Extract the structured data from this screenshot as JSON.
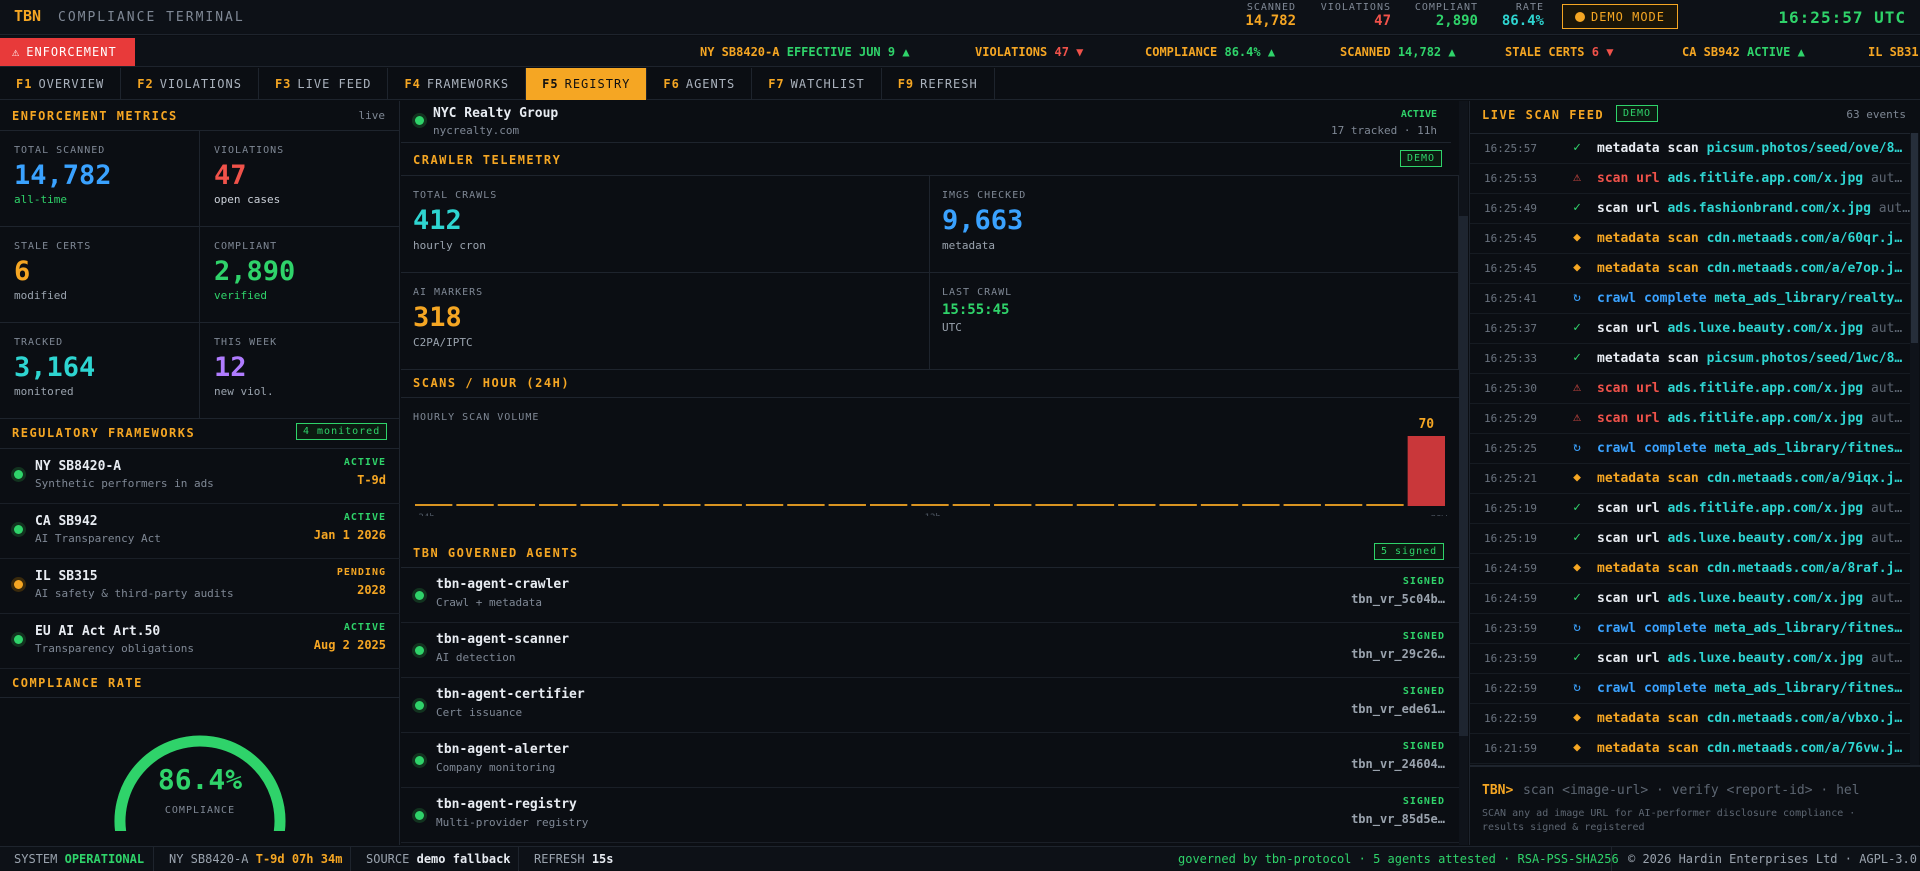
{
  "header": {
    "brand": "TBN",
    "subtitle": "COMPLIANCE TERMINAL",
    "stats": [
      {
        "label": "SCANNED",
        "value": "14,782"
      },
      {
        "label": "VIOLATIONS",
        "value": "47"
      },
      {
        "label": "COMPLIANT",
        "value": "2,890"
      },
      {
        "label": "RATE",
        "value": "86.4%"
      }
    ],
    "demo_mode": "DEMO MODE",
    "clock": "16:25:57 UTC"
  },
  "ticker": {
    "badge": "ENFORCEMENT",
    "items": [
      {
        "label": "NY SB8420-A",
        "value": "EFFECTIVE JUN 9",
        "arrow": "▲",
        "color": "#2fd36a"
      },
      {
        "label": "VIOLATIONS",
        "value": "47",
        "arrow": "▼",
        "color": "#f0524a"
      },
      {
        "label": "COMPLIANCE",
        "value": "86.4%",
        "arrow": "▲",
        "color": "#2fd36a"
      },
      {
        "label": "SCANNED",
        "value": "14,782",
        "arrow": "▲",
        "color": "#2fd36a"
      },
      {
        "label": "STALE CERTS",
        "value": "6",
        "arrow": "▼",
        "color": "#f0524a"
      },
      {
        "label": "CA SB942",
        "value": "ACTIVE",
        "arrow": "▲",
        "color": "#2fd36a"
      },
      {
        "label": "IL SB31",
        "value": "",
        "arrow": "",
        "color": "#2fd36a"
      }
    ]
  },
  "nav": [
    {
      "key": "F1",
      "label": "OVERVIEW"
    },
    {
      "key": "F2",
      "label": "VIOLATIONS"
    },
    {
      "key": "F3",
      "label": "LIVE FEED"
    },
    {
      "key": "F4",
      "label": "FRAMEWORKS"
    },
    {
      "key": "F5",
      "label": "REGISTRY"
    },
    {
      "key": "F6",
      "label": "AGENTS"
    },
    {
      "key": "F7",
      "label": "WATCHLIST"
    },
    {
      "key": "F9",
      "label": "REFRESH"
    }
  ],
  "metrics": {
    "title": "ENFORCEMENT METRICS",
    "tag": "live",
    "cells": [
      {
        "label": "TOTAL SCANNED",
        "value": "14,782",
        "sub": "all-time"
      },
      {
        "label": "VIOLATIONS",
        "value": "47",
        "sub": "open cases"
      },
      {
        "label": "STALE CERTS",
        "value": "6",
        "sub": "modified"
      },
      {
        "label": "COMPLIANT",
        "value": "2,890",
        "sub": "verified"
      },
      {
        "label": "TRACKED",
        "value": "3,164",
        "sub": "monitored"
      },
      {
        "label": "THIS WEEK",
        "value": "12",
        "sub": "new viol."
      }
    ]
  },
  "frameworks": {
    "title": "REGULATORY FRAMEWORKS",
    "badge": "4 monitored",
    "items": [
      {
        "name": "NY SB8420-A",
        "desc": "Synthetic performers in ads",
        "status": "ACTIVE",
        "date": "T-9d"
      },
      {
        "name": "CA SB942",
        "desc": "AI Transparency Act",
        "status": "ACTIVE",
        "date": "Jan 1 2026"
      },
      {
        "name": "IL SB315",
        "desc": "AI safety & third-party audits",
        "status": "PENDING",
        "date": "2028"
      },
      {
        "name": "EU AI Act Art.50",
        "desc": "Transparency obligations",
        "status": "ACTIVE",
        "date": "Aug 2 2025"
      }
    ]
  },
  "compliance": {
    "title": "COMPLIANCE RATE",
    "value": "86.4%",
    "fraction": 0.864,
    "label": "COMPLIANCE"
  },
  "registry_top": {
    "name": "NYC Realty Group",
    "domain": "nycrealty.com",
    "status": "ACTIVE",
    "meta": "17 tracked · 11h"
  },
  "telemetry": {
    "title": "CRAWLER TELEMETRY",
    "badge": "DEMO",
    "cells": [
      {
        "label": "TOTAL CRAWLS",
        "value": "412",
        "sub": "hourly cron"
      },
      {
        "label": "IMGS CHECKED",
        "value": "9,663",
        "sub": "metadata"
      },
      {
        "label": "AI MARKERS",
        "value": "318",
        "sub": "C2PA/IPTC"
      },
      {
        "label": "LAST CRAWL",
        "value": "15:55:45",
        "sub": "UTC"
      }
    ]
  },
  "scans_chart": {
    "title": "SCANS / HOUR (24H)",
    "subtitle": "HOURLY SCAN VOLUME",
    "peak_label": "70",
    "x_labels": [
      "-24h",
      "-12h",
      "now"
    ]
  },
  "chart_data": {
    "type": "bar",
    "title": "SCANS / HOUR (24H)",
    "subtitle": "HOURLY SCAN VOLUME",
    "categories": [
      "-24h",
      "",
      "",
      "",
      "",
      "",
      "",
      "",
      "",
      "",
      "",
      "",
      "-12h",
      "",
      "",
      "",
      "",
      "",
      "",
      "",
      "",
      "",
      "",
      "",
      "now"
    ],
    "values": [
      0,
      0,
      0,
      0,
      0,
      0,
      0,
      0,
      0,
      0,
      0,
      0,
      0,
      0,
      0,
      0,
      0,
      0,
      0,
      0,
      0,
      0,
      0,
      0,
      70
    ],
    "ylim": [
      0,
      70
    ]
  },
  "agents": {
    "title": "TBN GOVERNED AGENTS",
    "badge": "5 signed",
    "items": [
      {
        "name": "tbn-agent-crawler",
        "desc": "Crawl + metadata",
        "status": "SIGNED",
        "hash": "tbn_vr_5c04b…"
      },
      {
        "name": "tbn-agent-scanner",
        "desc": "AI detection",
        "status": "SIGNED",
        "hash": "tbn_vr_29c26…"
      },
      {
        "name": "tbn-agent-certifier",
        "desc": "Cert issuance",
        "status": "SIGNED",
        "hash": "tbn_vr_ede61…"
      },
      {
        "name": "tbn-agent-alerter",
        "desc": "Company monitoring",
        "status": "SIGNED",
        "hash": "tbn_vr_24604…"
      },
      {
        "name": "tbn-agent-registry",
        "desc": "Multi-provider registry",
        "status": "SIGNED",
        "hash": "tbn_vr_85d5e…"
      }
    ]
  },
  "feed": {
    "title": "LIVE SCAN FEED",
    "badge": "DEMO",
    "count": "63 events",
    "rows": [
      {
        "time": "16:25:57",
        "icon": "check",
        "action": "metadata scan",
        "target": "picsum.photos/seed/ove/8…"
      },
      {
        "time": "16:25:53",
        "icon": "warn",
        "action": "scan url",
        "target": "ads.fitlife.app.com/x.jpg",
        "tail": "aut…"
      },
      {
        "time": "16:25:49",
        "icon": "check",
        "action": "scan url",
        "target": "ads.fashionbrand.com/x.jpg",
        "tail": "aut…"
      },
      {
        "time": "16:25:45",
        "icon": "diamond",
        "action": "metadata scan",
        "target": "cdn.metaads.com/a/60qr.j…"
      },
      {
        "time": "16:25:45",
        "icon": "diamond",
        "action": "metadata scan",
        "target": "cdn.metaads.com/a/e7op.j…"
      },
      {
        "time": "16:25:41",
        "icon": "cycle",
        "action": "crawl complete",
        "target": "meta_ads_library/realty…"
      },
      {
        "time": "16:25:37",
        "icon": "check",
        "action": "scan url",
        "target": "ads.luxe.beauty.com/x.jpg",
        "tail": "aut…"
      },
      {
        "time": "16:25:33",
        "icon": "check",
        "action": "metadata scan",
        "target": "picsum.photos/seed/1wc/8…"
      },
      {
        "time": "16:25:30",
        "icon": "warn",
        "action": "scan url",
        "target": "ads.fitlife.app.com/x.jpg",
        "tail": "aut…"
      },
      {
        "time": "16:25:29",
        "icon": "warn",
        "action": "scan url",
        "target": "ads.fitlife.app.com/x.jpg",
        "tail": "aut…"
      },
      {
        "time": "16:25:25",
        "icon": "cycle",
        "action": "crawl complete",
        "target": "meta_ads_library/fitnes…"
      },
      {
        "time": "16:25:21",
        "icon": "diamond",
        "action": "metadata scan",
        "target": "cdn.metaads.com/a/9iqx.j…"
      },
      {
        "time": "16:25:19",
        "icon": "check",
        "action": "scan url",
        "target": "ads.fitlife.app.com/x.jpg",
        "tail": "aut…"
      },
      {
        "time": "16:25:19",
        "icon": "check",
        "action": "scan url",
        "target": "ads.luxe.beauty.com/x.jpg",
        "tail": "aut…"
      },
      {
        "time": "16:24:59",
        "icon": "diamond",
        "action": "metadata scan",
        "target": "cdn.metaads.com/a/8raf.j…"
      },
      {
        "time": "16:24:59",
        "icon": "check",
        "action": "scan url",
        "target": "ads.luxe.beauty.com/x.jpg",
        "tail": "aut…"
      },
      {
        "time": "16:23:59",
        "icon": "cycle",
        "action": "crawl complete",
        "target": "meta_ads_library/fitnes…"
      },
      {
        "time": "16:23:59",
        "icon": "check",
        "action": "scan url",
        "target": "ads.luxe.beauty.com/x.jpg",
        "tail": "aut…"
      },
      {
        "time": "16:22:59",
        "icon": "cycle",
        "action": "crawl complete",
        "target": "meta_ads_library/fitnes…"
      },
      {
        "time": "16:22:59",
        "icon": "diamond",
        "action": "metadata scan",
        "target": "cdn.metaads.com/a/vbxo.j…"
      },
      {
        "time": "16:21:59",
        "icon": "diamond",
        "action": "metadata scan",
        "target": "cdn.metaads.com/a/76vw.j…"
      }
    ]
  },
  "terminal": {
    "prompt": "TBN>",
    "hint": "scan <image-url>  ·  verify <report-id>  ·  hel",
    "help": "SCAN any ad image URL for AI-performer disclosure compliance · results signed & registered"
  },
  "status": {
    "system_label": "SYSTEM",
    "system_value": "OPERATIONAL",
    "countdown_label": "NY SB8420-A",
    "countdown_value": "T-9d 07h 34m",
    "source_label": "SOURCE",
    "source_value": "demo fallback",
    "refresh_label": "REFRESH",
    "refresh_value": "15s",
    "governed": "governed by tbn-protocol · 5 agents attested · RSA-PSS-SHA256",
    "copyright": "© 2026 Hardin Enterprises Ltd · AGPL-3.0"
  },
  "colors": {
    "accent": "#f5a623",
    "danger": "#f0524a",
    "ok": "#2fd36a",
    "info": "#3aa2ff",
    "cyan": "#2ed5d1",
    "purple": "#b07cff"
  }
}
